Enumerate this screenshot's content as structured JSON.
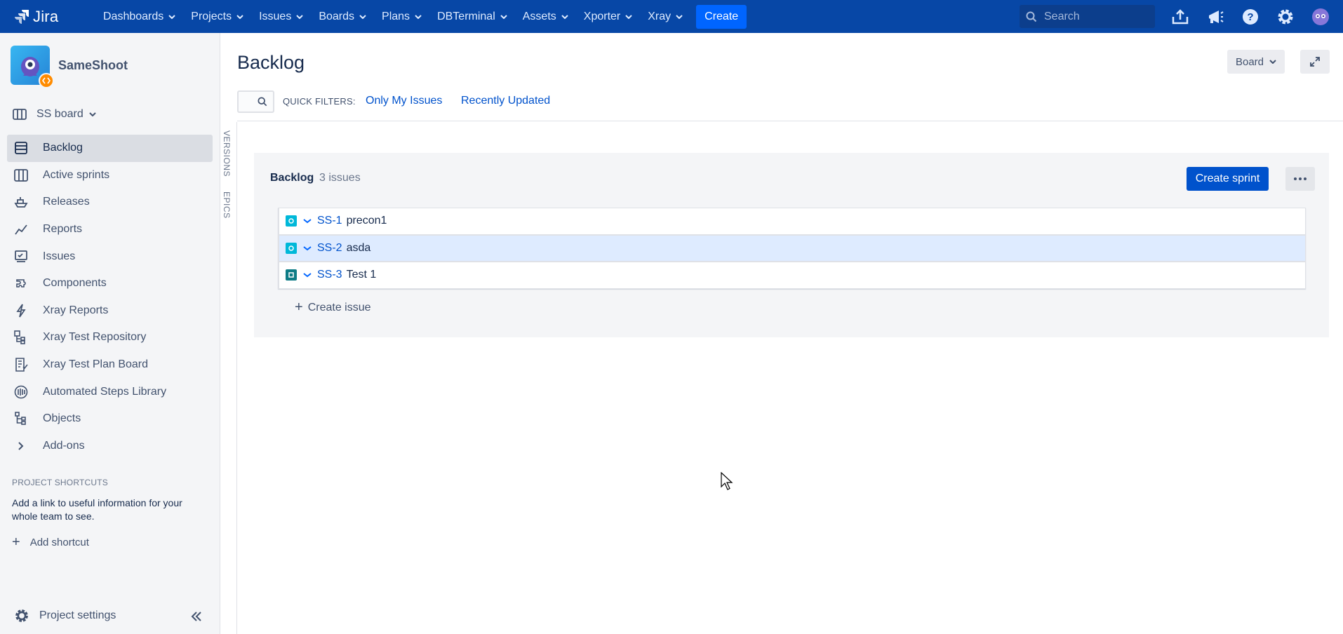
{
  "topnav": {
    "logo_text": "Jira",
    "menu": [
      "Dashboards",
      "Projects",
      "Issues",
      "Boards",
      "Plans",
      "DBTerminal",
      "Assets",
      "Xporter",
      "Xray"
    ],
    "create_label": "Create",
    "search_placeholder": "Search",
    "icons": [
      "upload-icon",
      "megaphone-icon",
      "help-icon",
      "settings-icon",
      "user-avatar-icon"
    ]
  },
  "sidebar": {
    "project_name": "SameShoot",
    "board_label": "SS board",
    "items": [
      {
        "label": "Backlog",
        "icon": "backlog-icon",
        "active": true
      },
      {
        "label": "Active sprints",
        "icon": "active-sprints-icon",
        "active": false
      },
      {
        "label": "Releases",
        "icon": "releases-icon",
        "active": false
      },
      {
        "label": "Reports",
        "icon": "reports-icon",
        "active": false
      },
      {
        "label": "Issues",
        "icon": "issues-icon",
        "active": false
      },
      {
        "label": "Components",
        "icon": "components-icon",
        "active": false
      },
      {
        "label": "Xray Reports",
        "icon": "xray-reports-icon",
        "active": false
      },
      {
        "label": "Xray Test Repository",
        "icon": "xray-test-repository-icon",
        "active": false
      },
      {
        "label": "Xray Test Plan Board",
        "icon": "xray-test-plan-board-icon",
        "active": false
      },
      {
        "label": "Automated Steps Library",
        "icon": "automated-steps-library-icon",
        "active": false
      },
      {
        "label": "Objects",
        "icon": "objects-icon",
        "active": false
      },
      {
        "label": "Add-ons",
        "icon": "chevron-right-icon",
        "active": false
      }
    ],
    "shortcuts_heading": "PROJECT SHORTCUTS",
    "shortcuts_desc": "Add a link to useful information for your whole team to see.",
    "add_shortcut_label": "Add shortcut",
    "settings_label": "Project settings"
  },
  "vtabs": {
    "versions": "VERSIONS",
    "epics": "EPICS"
  },
  "main": {
    "title": "Backlog",
    "board_button": "Board",
    "quick_filters_label": "QUICK FILTERS:",
    "quick_filters": [
      "Only My Issues",
      "Recently Updated"
    ]
  },
  "backlog": {
    "title": "Backlog",
    "count": "3 issues",
    "create_sprint_label": "Create sprint",
    "issues": [
      {
        "key": "SS-1",
        "summary": "precon1",
        "selected": false,
        "type_color": "#00b8d9"
      },
      {
        "key": "SS-2",
        "summary": "asda",
        "selected": true,
        "type_color": "#00b8d9"
      },
      {
        "key": "SS-3",
        "summary": "Test 1",
        "selected": false,
        "type_color": "#0e7c86"
      }
    ],
    "create_issue_label": "Create issue"
  },
  "colors": {
    "nav_bg": "#0747a6",
    "primary": "#0052cc",
    "selected_row": "#deebff"
  }
}
